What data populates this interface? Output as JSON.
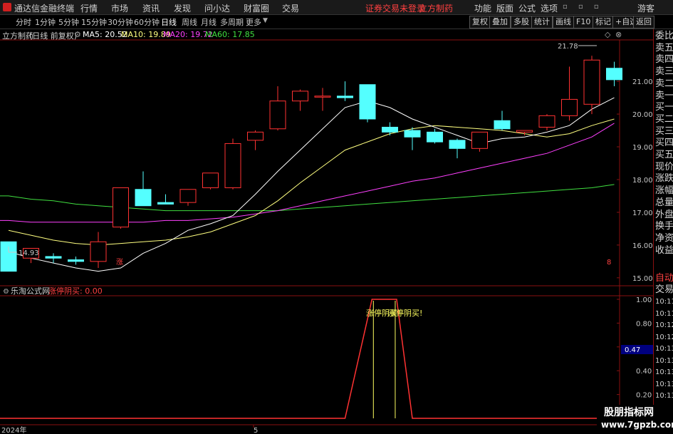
{
  "app": {
    "title": "通达信金融终端",
    "menu": [
      "行情",
      "市场",
      "资讯",
      "发现",
      "问小达",
      "财富圈",
      "交易"
    ],
    "warning": "证券交易未登录",
    "stock_name_top": "立方制药",
    "right_menu": [
      "功能",
      "版面",
      "公式",
      "选项"
    ],
    "guest": "游客"
  },
  "periods": [
    "分时",
    "1分钟",
    "5分钟",
    "15分钟",
    "30分钟",
    "60分钟",
    "日线",
    "周线",
    "月线",
    "多周期",
    "更多"
  ],
  "active_period": "日线",
  "toolbar_right": [
    "复权",
    "叠加",
    "多股",
    "统计",
    "画线",
    "F10",
    "标记",
    "+自选",
    "返回"
  ],
  "info": {
    "stock": "立方制药",
    "mode": "(日线 前复权)",
    "ma5": "MA5: 20.52",
    "ma10": "MA10: 19.89",
    "ma20": "MA20: 19.72",
    "ma60": "MA60: 17.85"
  },
  "colors": {
    "up": "#ff3232",
    "down": "#54ffff",
    "ma5": "#ffffff",
    "ma10": "#ffff80",
    "ma20": "#ff40ff",
    "ma60": "#40e040",
    "frame": "#8a1010"
  },
  "price_axis": [
    "21.00",
    "20.00",
    "19.00",
    "18.00",
    "17.00",
    "16.00",
    "15.00"
  ],
  "annotations": {
    "high": "21.78",
    "low": "14.93",
    "zhang": "涨",
    "eight": "8"
  },
  "indicator": {
    "name": "乐淘公式网",
    "signal_label": "涨停阴买: 0.00",
    "axis": [
      "1.00",
      "0.80",
      "0.60",
      "0.40",
      "0.20"
    ],
    "current_value": "0.47",
    "text1": "涨停阴买!",
    "text2": "涨停阴买!"
  },
  "xaxis": {
    "year": "2024年",
    "month": "5"
  },
  "side_panel": [
    "委比",
    "卖五",
    "卖四",
    "卖三",
    "卖二",
    "卖一",
    "买一",
    "买二",
    "买三",
    "买四",
    "买五",
    "现价",
    "涨跌",
    "涨幅",
    "总量",
    "外盘",
    "换手",
    "净资",
    "收益"
  ],
  "side_lower": [
    "自动",
    "交易"
  ],
  "times": [
    "10:11",
    "10:11",
    "10:12",
    "10:12",
    "10:13",
    "10:13",
    "10:13",
    "10:13",
    "10:13",
    "10:13",
    "10:13"
  ],
  "watermark": {
    "title": "股朋指标网",
    "url": "www.7gpzb.com"
  },
  "chart_data": {
    "type": "candlestick",
    "candles": [
      {
        "o": 16.1,
        "h": 16.1,
        "l": 15.2,
        "c": 15.2
      },
      {
        "o": 15.6,
        "h": 15.9,
        "l": 15.45,
        "c": 15.9
      },
      {
        "o": 15.65,
        "h": 15.75,
        "l": 15.45,
        "c": 15.6
      },
      {
        "o": 15.55,
        "h": 15.65,
        "l": 15.4,
        "c": 15.5
      },
      {
        "o": 15.5,
        "h": 16.4,
        "l": 15.3,
        "c": 16.1
      },
      {
        "o": 16.55,
        "h": 17.75,
        "l": 16.5,
        "c": 17.75
      },
      {
        "o": 17.7,
        "h": 18.25,
        "l": 17.45,
        "c": 17.2
      },
      {
        "o": 17.3,
        "h": 17.55,
        "l": 17.25,
        "c": 17.25
      },
      {
        "o": 17.3,
        "h": 17.7,
        "l": 17.2,
        "c": 17.7
      },
      {
        "o": 17.75,
        "h": 18.2,
        "l": 17.7,
        "c": 18.2
      },
      {
        "o": 17.75,
        "h": 19.25,
        "l": 17.7,
        "c": 19.1
      },
      {
        "o": 19.2,
        "h": 19.5,
        "l": 18.9,
        "c": 19.45
      },
      {
        "o": 19.55,
        "h": 20.85,
        "l": 19.5,
        "c": 20.4
      },
      {
        "o": 20.4,
        "h": 20.75,
        "l": 20.1,
        "c": 20.7
      },
      {
        "o": 20.55,
        "h": 20.8,
        "l": 20.1,
        "c": 20.55
      },
      {
        "o": 20.55,
        "h": 21.0,
        "l": 20.4,
        "c": 20.5
      },
      {
        "o": 20.9,
        "h": 20.9,
        "l": 19.75,
        "c": 19.85
      },
      {
        "o": 19.6,
        "h": 19.75,
        "l": 19.35,
        "c": 19.45
      },
      {
        "o": 19.5,
        "h": 19.6,
        "l": 18.9,
        "c": 19.3
      },
      {
        "o": 19.45,
        "h": 19.55,
        "l": 19.1,
        "c": 19.15
      },
      {
        "o": 19.2,
        "h": 19.25,
        "l": 18.65,
        "c": 18.95
      },
      {
        "o": 18.95,
        "h": 19.45,
        "l": 18.85,
        "c": 19.45
      },
      {
        "o": 19.8,
        "h": 20.1,
        "l": 19.5,
        "c": 19.55
      },
      {
        "o": 19.45,
        "h": 19.5,
        "l": 19.35,
        "c": 19.5
      },
      {
        "o": 19.6,
        "h": 20.0,
        "l": 19.5,
        "c": 19.95
      },
      {
        "o": 19.95,
        "h": 21.45,
        "l": 19.8,
        "c": 20.45
      },
      {
        "o": 20.3,
        "h": 21.78,
        "l": 20.0,
        "c": 21.65
      },
      {
        "o": 21.4,
        "h": 21.6,
        "l": 20.85,
        "c": 21.05
      }
    ],
    "ma5": [
      15.8,
      15.6,
      15.45,
      15.3,
      15.2,
      15.3,
      15.75,
      16.05,
      16.45,
      16.65,
      16.9,
      17.55,
      18.25,
      18.9,
      19.55,
      20.2,
      20.4,
      20.2,
      19.85,
      19.6,
      19.35,
      19.1,
      19.25,
      19.3,
      19.45,
      19.65,
      20.15,
      20.5
    ],
    "ma10": [
      16.45,
      16.3,
      16.15,
      16.05,
      16.0,
      16.05,
      16.1,
      16.15,
      16.25,
      16.4,
      16.65,
      16.9,
      17.35,
      17.9,
      18.4,
      18.9,
      19.15,
      19.4,
      19.55,
      19.65,
      19.6,
      19.55,
      19.5,
      19.4,
      19.3,
      19.4,
      19.65,
      19.85
    ],
    "ma20": [
      16.75,
      16.7,
      16.7,
      16.7,
      16.7,
      16.7,
      16.7,
      16.75,
      16.75,
      16.8,
      16.85,
      16.95,
      17.05,
      17.2,
      17.35,
      17.5,
      17.65,
      17.8,
      17.95,
      18.05,
      18.2,
      18.35,
      18.5,
      18.65,
      18.8,
      19.05,
      19.3,
      19.72
    ],
    "ma60": [
      17.5,
      17.4,
      17.35,
      17.25,
      17.2,
      17.15,
      17.1,
      17.05,
      17.05,
      17.05,
      17.05,
      17.05,
      17.05,
      17.1,
      17.15,
      17.2,
      17.25,
      17.3,
      17.35,
      17.4,
      17.45,
      17.5,
      17.55,
      17.6,
      17.65,
      17.7,
      17.75,
      17.85
    ],
    "ylim": [
      14.8,
      22.2
    ],
    "signal": {
      "low": 0.0,
      "high": 1.0,
      "rise_start_index": 15.0,
      "top_start_index": 16.2,
      "top_end_index": 17.3,
      "fall_end_index": 18.0
    }
  }
}
